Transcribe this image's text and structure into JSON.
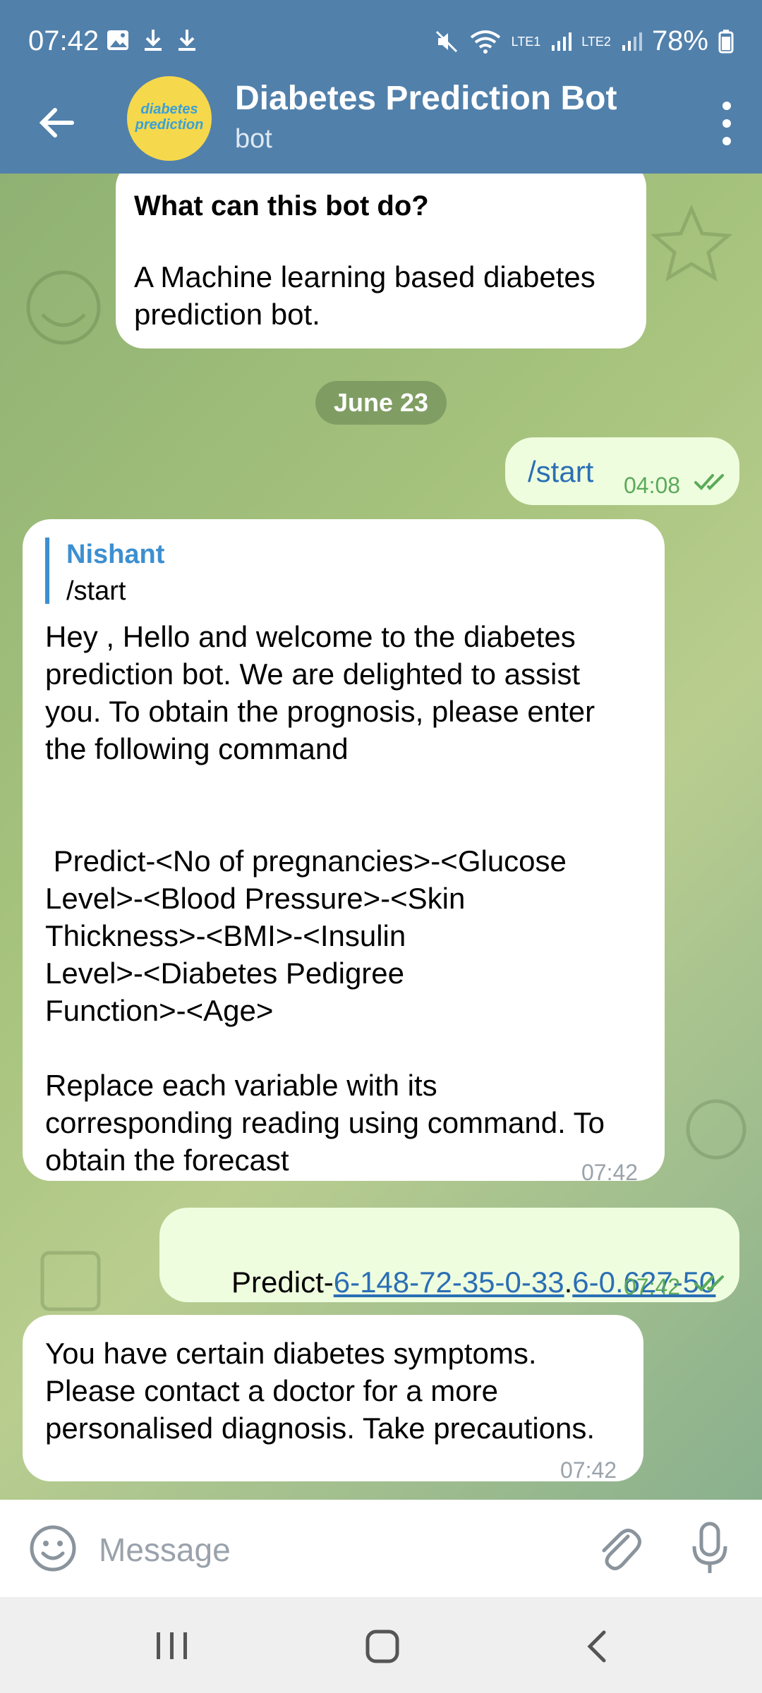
{
  "status_bar": {
    "time": "07:42",
    "battery": "78%",
    "sim1": "LTE1",
    "sim2": "LTE2"
  },
  "chat_header": {
    "title": "Diabetes Prediction Bot",
    "subtitle": "bot",
    "avatar_line1": "diabetes",
    "avatar_line2": "prediction"
  },
  "bot_intro": {
    "heading": "What can this bot do?",
    "line1": "A Machine learning based diabetes",
    "line2": "prediction bot."
  },
  "date_chip": "June 23",
  "messages": [
    {
      "text": "/start",
      "time": "04:08"
    },
    {
      "reply_author": "Nishant",
      "reply_text": "/start",
      "lines": [
        "Hey , Hello and welcome to the diabetes",
        "prediction bot. We are delighted to assist",
        "you. To obtain the prognosis, please enter",
        "the following command",
        " Predict-<No of pregnancies>-<Glucose",
        "Level>-<Blood Pressure>-<Skin",
        "Thickness>-<BMI>-<Insulin",
        "Level>-<Diabetes Pedigree",
        "Function>-<Age>",
        "Replace each variable with its",
        "corresponding reading using command. To",
        "obtain the forecast"
      ],
      "time": "07:42"
    },
    {
      "prefix": "Predict-",
      "link1": "6-148-72-35-0-33",
      "dot": ".",
      "link2": "6-0.627-50",
      "time": "07:42"
    },
    {
      "lines": [
        "You have certain diabetes symptoms.",
        "Please contact a doctor for a more",
        "personalised diagnosis. Take precautions."
      ],
      "time": "07:42"
    }
  ],
  "input": {
    "placeholder": "Message"
  },
  "colors": {
    "header": "#5180ab",
    "outgoing": "#effddf",
    "link": "#2a6fb5",
    "read_check": "#5aaa5a"
  }
}
